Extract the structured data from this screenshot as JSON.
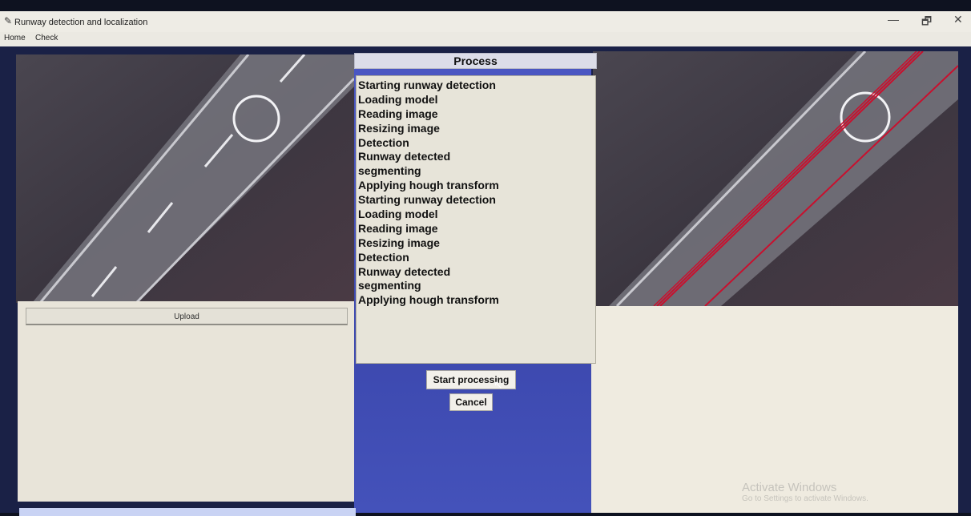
{
  "window": {
    "title": "Runway detection and localization",
    "minimize_glyph": "—",
    "maximize_glyph": "🗗",
    "close_glyph": "✕"
  },
  "menu": {
    "items": [
      "Home",
      "Check"
    ]
  },
  "left": {
    "upload_label": "Upload"
  },
  "process": {
    "header": "Process",
    "log": [
      "Starting runway detection",
      "Loading model",
      "Reading image",
      "Resizing image",
      "Detection",
      "Runway detected",
      "segmenting",
      "Applying hough transform",
      "Starting runway detection",
      "Loading model",
      "Reading image",
      "Resizing image",
      "Detection",
      "Runway detected",
      "segmenting",
      "Applying hough transform"
    ],
    "start_label": "Start processing",
    "cancel_label": "Cancel"
  },
  "watermark": {
    "line1": "Activate Windows",
    "line2": "Go to Settings to activate Windows."
  },
  "colors": {
    "detection_line": "#c8102e",
    "process_bg": "#4552bc"
  }
}
